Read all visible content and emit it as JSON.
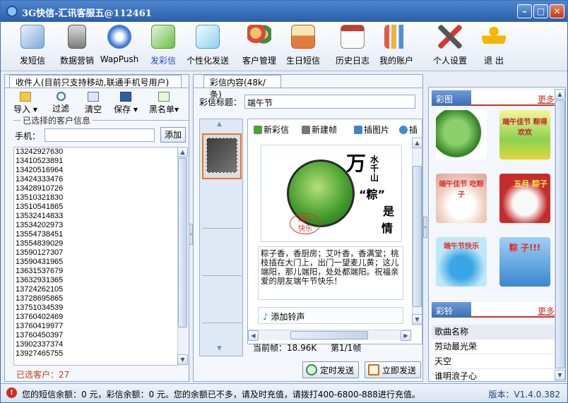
{
  "window": {
    "title": "3G快信-汇讯客服五@112461"
  },
  "toolbar": {
    "items": [
      {
        "label": "发短信"
      },
      {
        "label": "数据营销"
      },
      {
        "label": "WapPush"
      },
      {
        "label": "发彩信"
      },
      {
        "label": "个性化发送"
      },
      {
        "label": "客户管理"
      },
      {
        "label": "生日短信"
      },
      {
        "label": "历史日志"
      },
      {
        "label": "我的账户"
      },
      {
        "label": "个人设置"
      },
      {
        "label": "退 出"
      }
    ],
    "active": "发彩信"
  },
  "left": {
    "tab": "收件人(目前只支持移动,联通手机号用户)",
    "tools": [
      {
        "label": "导入"
      },
      {
        "label": "过滤"
      },
      {
        "label": "清空"
      },
      {
        "label": "保存"
      },
      {
        "label": "黑名单"
      }
    ],
    "group_label": "已选择的客户信息",
    "phone_label": "手机：",
    "phone_value": "",
    "add_label": "添加",
    "numbers": [
      "13242927630",
      "13410523891",
      "13420516964",
      "13424333476",
      "13428910726",
      "13510321830",
      "13510541865",
      "13532414833",
      "13534202973",
      "13554738451",
      "13554839029",
      "13590127307",
      "13590431965",
      "13631537679",
      "13632931365",
      "13724262105",
      "13728695865",
      "13751034539",
      "13760402469",
      "13760419977",
      "13760450397",
      "13902337374",
      "13927465755"
    ],
    "selected_count": "已选客户：27"
  },
  "middle": {
    "tab": "彩信内容(48k/条)",
    "subject_label": "彩信标题：",
    "subject_value": "端午节",
    "tools": [
      {
        "label": "新彩信"
      },
      {
        "label": "新建帧"
      },
      {
        "label": "插图片"
      },
      {
        "label": "插"
      }
    ],
    "image_text": {
      "big": "万",
      "line": "水千山",
      "zong": "“粽”",
      "shi": "是",
      "qing": "情",
      "stamp1": "端午",
      "stamp2": "快乐"
    },
    "message": "粽子香，香厨房；艾叶香，香满堂；桃枝插在大门上，出门一望麦儿黄；这儿端阳，那儿端阳，处处都端阳。祝福亲爱的朋友端午节快乐！",
    "ring_label": "添加铃声",
    "frame_size": "当前帧：18.96K",
    "frame_page": "第1/1帧",
    "timed_send": "定时发送",
    "send_now": "立即发送"
  },
  "right": {
    "pictures_tab": "彩图",
    "more": "更多",
    "picture_captions": [
      "",
      "端午佳节 粽得欢欢",
      "端午佳节 吃粽子",
      "五月 粽子",
      "端午节快乐",
      "粽 子!!!"
    ],
    "ring_tab": "彩铃",
    "songs_header": "歌曲名称",
    "songs": [
      "劳动最光荣",
      "天空",
      "谁明浪子心"
    ]
  },
  "status": {
    "message": "您的短信余额：0 元，彩信余额：0 元。您的余额已不多，请及时充值，请拨打400-6800-888进行充值。",
    "version": "版本：V1.4.0.382"
  },
  "colors": {
    "accent": "#3e6cb5",
    "title": "#2a5ea8",
    "more": "#c7342b"
  }
}
